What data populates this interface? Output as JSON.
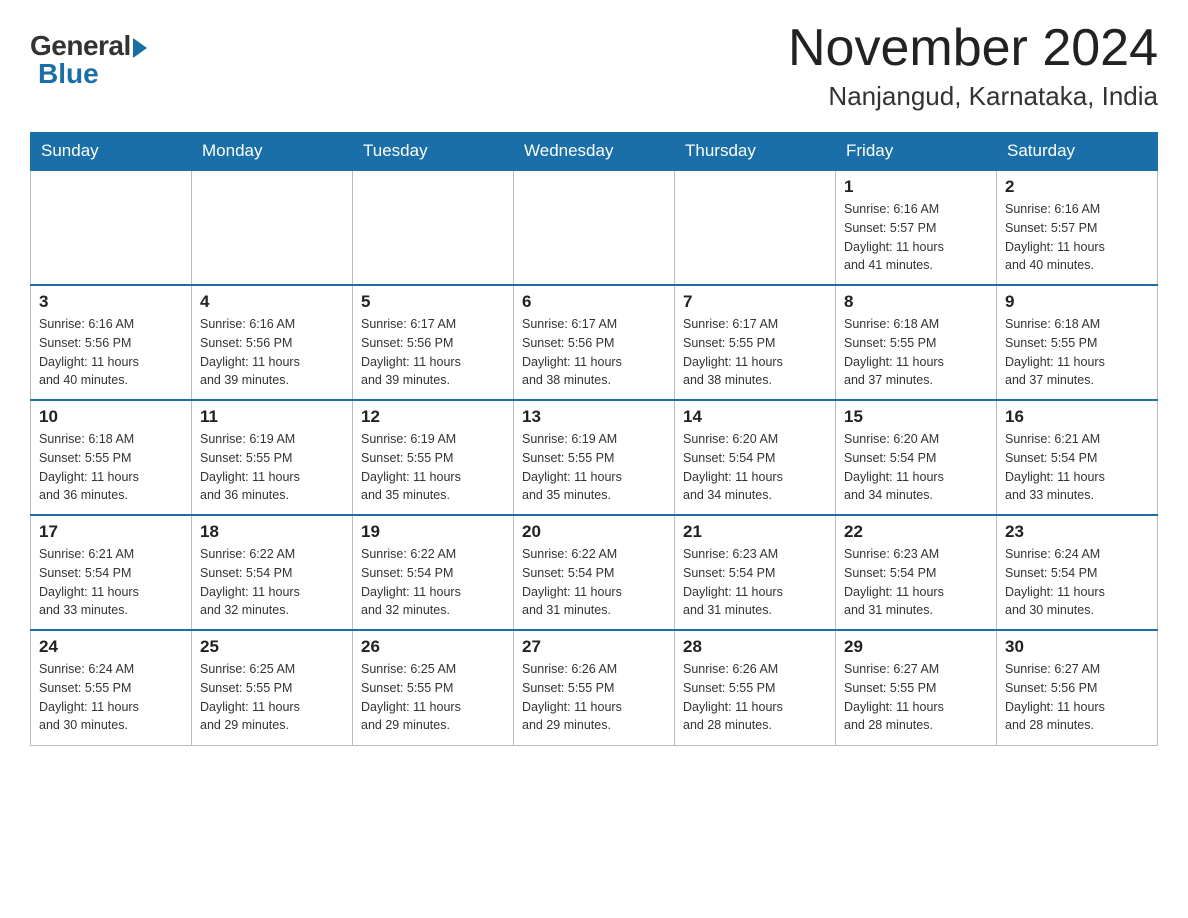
{
  "header": {
    "logo": {
      "general": "General",
      "blue": "Blue"
    },
    "title": "November 2024",
    "location": "Nanjangud, Karnataka, India"
  },
  "weekdays": [
    "Sunday",
    "Monday",
    "Tuesday",
    "Wednesday",
    "Thursday",
    "Friday",
    "Saturday"
  ],
  "weeks": [
    {
      "days": [
        {
          "num": "",
          "info": ""
        },
        {
          "num": "",
          "info": ""
        },
        {
          "num": "",
          "info": ""
        },
        {
          "num": "",
          "info": ""
        },
        {
          "num": "",
          "info": ""
        },
        {
          "num": "1",
          "info": "Sunrise: 6:16 AM\nSunset: 5:57 PM\nDaylight: 11 hours\nand 41 minutes."
        },
        {
          "num": "2",
          "info": "Sunrise: 6:16 AM\nSunset: 5:57 PM\nDaylight: 11 hours\nand 40 minutes."
        }
      ]
    },
    {
      "days": [
        {
          "num": "3",
          "info": "Sunrise: 6:16 AM\nSunset: 5:56 PM\nDaylight: 11 hours\nand 40 minutes."
        },
        {
          "num": "4",
          "info": "Sunrise: 6:16 AM\nSunset: 5:56 PM\nDaylight: 11 hours\nand 39 minutes."
        },
        {
          "num": "5",
          "info": "Sunrise: 6:17 AM\nSunset: 5:56 PM\nDaylight: 11 hours\nand 39 minutes."
        },
        {
          "num": "6",
          "info": "Sunrise: 6:17 AM\nSunset: 5:56 PM\nDaylight: 11 hours\nand 38 minutes."
        },
        {
          "num": "7",
          "info": "Sunrise: 6:17 AM\nSunset: 5:55 PM\nDaylight: 11 hours\nand 38 minutes."
        },
        {
          "num": "8",
          "info": "Sunrise: 6:18 AM\nSunset: 5:55 PM\nDaylight: 11 hours\nand 37 minutes."
        },
        {
          "num": "9",
          "info": "Sunrise: 6:18 AM\nSunset: 5:55 PM\nDaylight: 11 hours\nand 37 minutes."
        }
      ]
    },
    {
      "days": [
        {
          "num": "10",
          "info": "Sunrise: 6:18 AM\nSunset: 5:55 PM\nDaylight: 11 hours\nand 36 minutes."
        },
        {
          "num": "11",
          "info": "Sunrise: 6:19 AM\nSunset: 5:55 PM\nDaylight: 11 hours\nand 36 minutes."
        },
        {
          "num": "12",
          "info": "Sunrise: 6:19 AM\nSunset: 5:55 PM\nDaylight: 11 hours\nand 35 minutes."
        },
        {
          "num": "13",
          "info": "Sunrise: 6:19 AM\nSunset: 5:55 PM\nDaylight: 11 hours\nand 35 minutes."
        },
        {
          "num": "14",
          "info": "Sunrise: 6:20 AM\nSunset: 5:54 PM\nDaylight: 11 hours\nand 34 minutes."
        },
        {
          "num": "15",
          "info": "Sunrise: 6:20 AM\nSunset: 5:54 PM\nDaylight: 11 hours\nand 34 minutes."
        },
        {
          "num": "16",
          "info": "Sunrise: 6:21 AM\nSunset: 5:54 PM\nDaylight: 11 hours\nand 33 minutes."
        }
      ]
    },
    {
      "days": [
        {
          "num": "17",
          "info": "Sunrise: 6:21 AM\nSunset: 5:54 PM\nDaylight: 11 hours\nand 33 minutes."
        },
        {
          "num": "18",
          "info": "Sunrise: 6:22 AM\nSunset: 5:54 PM\nDaylight: 11 hours\nand 32 minutes."
        },
        {
          "num": "19",
          "info": "Sunrise: 6:22 AM\nSunset: 5:54 PM\nDaylight: 11 hours\nand 32 minutes."
        },
        {
          "num": "20",
          "info": "Sunrise: 6:22 AM\nSunset: 5:54 PM\nDaylight: 11 hours\nand 31 minutes."
        },
        {
          "num": "21",
          "info": "Sunrise: 6:23 AM\nSunset: 5:54 PM\nDaylight: 11 hours\nand 31 minutes."
        },
        {
          "num": "22",
          "info": "Sunrise: 6:23 AM\nSunset: 5:54 PM\nDaylight: 11 hours\nand 31 minutes."
        },
        {
          "num": "23",
          "info": "Sunrise: 6:24 AM\nSunset: 5:54 PM\nDaylight: 11 hours\nand 30 minutes."
        }
      ]
    },
    {
      "days": [
        {
          "num": "24",
          "info": "Sunrise: 6:24 AM\nSunset: 5:55 PM\nDaylight: 11 hours\nand 30 minutes."
        },
        {
          "num": "25",
          "info": "Sunrise: 6:25 AM\nSunset: 5:55 PM\nDaylight: 11 hours\nand 29 minutes."
        },
        {
          "num": "26",
          "info": "Sunrise: 6:25 AM\nSunset: 5:55 PM\nDaylight: 11 hours\nand 29 minutes."
        },
        {
          "num": "27",
          "info": "Sunrise: 6:26 AM\nSunset: 5:55 PM\nDaylight: 11 hours\nand 29 minutes."
        },
        {
          "num": "28",
          "info": "Sunrise: 6:26 AM\nSunset: 5:55 PM\nDaylight: 11 hours\nand 28 minutes."
        },
        {
          "num": "29",
          "info": "Sunrise: 6:27 AM\nSunset: 5:55 PM\nDaylight: 11 hours\nand 28 minutes."
        },
        {
          "num": "30",
          "info": "Sunrise: 6:27 AM\nSunset: 5:56 PM\nDaylight: 11 hours\nand 28 minutes."
        }
      ]
    }
  ]
}
